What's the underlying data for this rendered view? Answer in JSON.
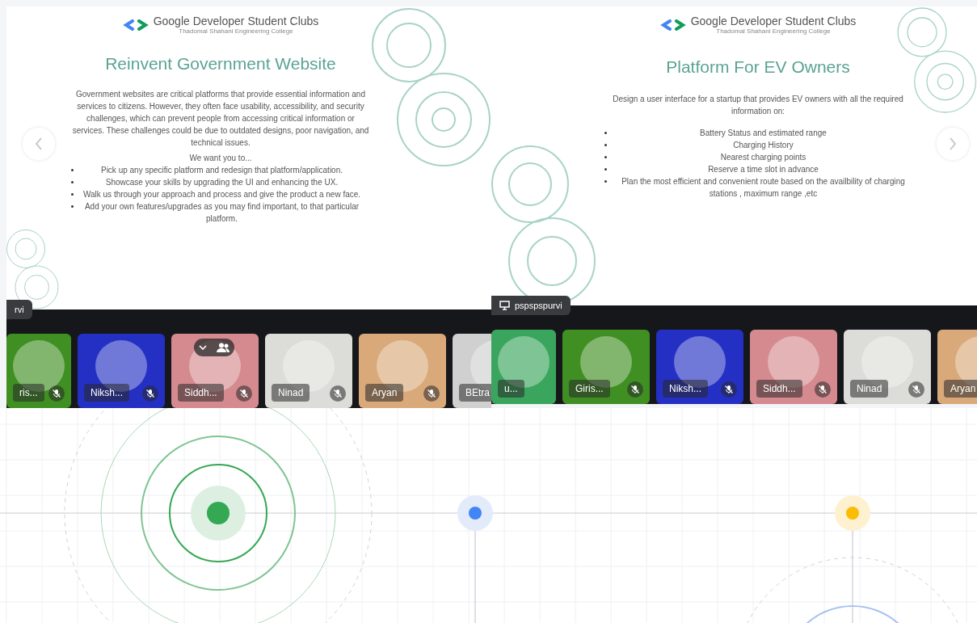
{
  "panels": [
    {
      "slide": {
        "org": "Google Developer Student Clubs",
        "college": "Thadomal Shahani Engineering College",
        "title": "Reinvent Government Website",
        "paragraph": "Government websites are critical platforms that provide essential information and services to citizens. However, they often face usability, accessibility, and security challenges, which can prevent people from accessing critical information or services. These challenges could be due to outdated designs, poor navigation, and technical issues.",
        "intro": "We want you to...",
        "bullets": [
          "Pick up any specific platform and redesign that platform/application.",
          "Showcase your skills by upgrading the UI and enhancing the UX.",
          "Walk us through your approach and process and give the product a new face.",
          "Add your own features/upgrades as you may find important, to that particular platform."
        ],
        "nav_button": {
          "kind": "previous"
        }
      },
      "presenter": {
        "name": "rvi",
        "screen_icon": false
      },
      "tiles": [
        {
          "name": "ris...",
          "color": "#3f8f22",
          "muted": true,
          "hover_controls": false
        },
        {
          "name": "Niksh...",
          "color": "#2430c4",
          "muted": true,
          "hover_controls": false
        },
        {
          "name": "Siddh...",
          "color": "#d48a8f",
          "muted": true,
          "hover_controls": true
        },
        {
          "name": "Ninad",
          "color": "#dcdcd8",
          "muted": true,
          "hover_controls": false
        },
        {
          "name": "Aryan",
          "color": "#d9a97a",
          "muted": true,
          "hover_controls": false
        },
        {
          "name": "BEtra",
          "color": "#d0d0d0",
          "muted": false,
          "hover_controls": false
        }
      ]
    },
    {
      "slide": {
        "org": "Google Developer Student Clubs",
        "college": "Thadomal Shahani Engineering College",
        "title": "Platform For EV Owners",
        "paragraph": "Design a user interface for a startup that provides EV owners with all the required information on:",
        "bullets": [
          "Battery Status and estimated range",
          "Charging History",
          "Nearest charging points",
          "Reserve a time slot in advance",
          "Plan the most efficient and convenient route based on the availbility of charging stations , maximum range ,etc"
        ],
        "nav_button": {
          "kind": "next"
        }
      },
      "presenter": {
        "name": "pspspspurvi",
        "screen_icon": true
      },
      "tiles": [
        {
          "name": "u...",
          "color": "#3aa55c",
          "muted": false,
          "hover_controls": false
        },
        {
          "name": "Giris...",
          "color": "#3f8f22",
          "muted": true,
          "hover_controls": false
        },
        {
          "name": "Niksh...",
          "color": "#2430c4",
          "muted": true,
          "hover_controls": false
        },
        {
          "name": "Siddh...",
          "color": "#d48a8f",
          "muted": true,
          "hover_controls": false
        },
        {
          "name": "Ninad",
          "color": "#dcdcd8",
          "muted": true,
          "hover_controls": false
        },
        {
          "name": "Aryan",
          "color": "#d9a97a",
          "muted": false,
          "hover_controls": false
        }
      ]
    }
  ]
}
